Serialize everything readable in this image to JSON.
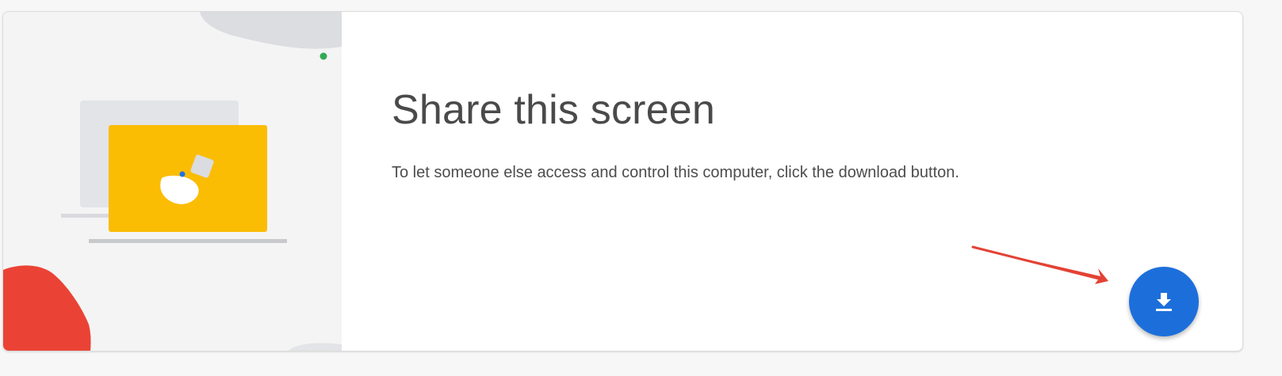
{
  "card": {
    "title": "Share this screen",
    "description": "To let someone else access and control this computer, click the download button."
  },
  "download_button": {
    "icon": "download-icon",
    "color": "#1c6fdb"
  },
  "illustration": {
    "icon": "laptop-illustration",
    "accent_colors": {
      "laptop": "#fbbc04",
      "blob_red": "#ea4335",
      "dot_green": "#34a853",
      "dot_blue": "#1a73e8"
    }
  },
  "annotation": {
    "icon": "red-arrow-icon",
    "color": "#e34234"
  }
}
